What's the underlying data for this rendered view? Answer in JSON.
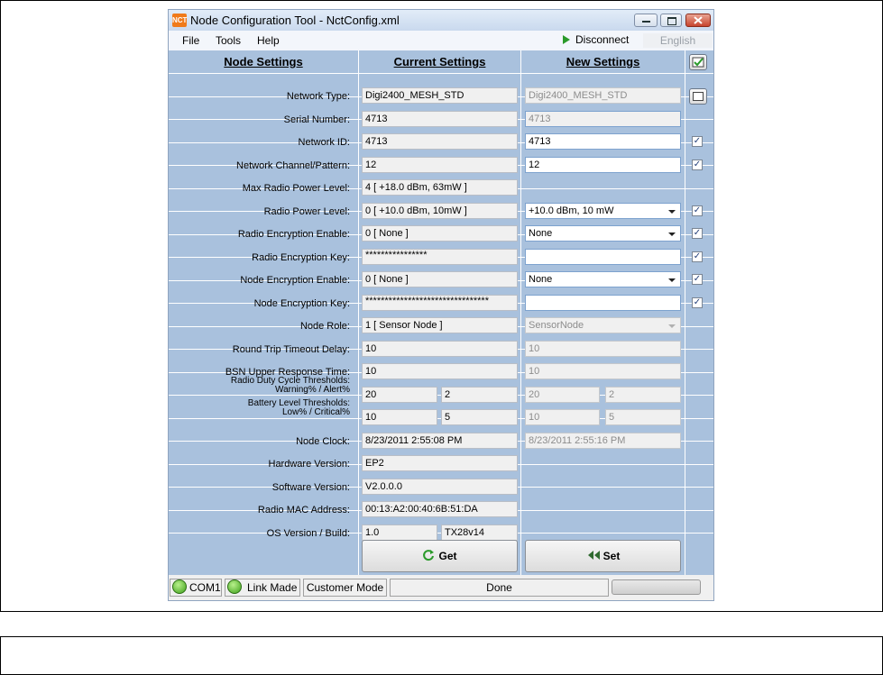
{
  "window": {
    "app_icon_text": "NCT",
    "title": "Node Configuration Tool - NctConfig.xml"
  },
  "menu": {
    "items": [
      "File",
      "Tools",
      "Help"
    ],
    "disconnect": "Disconnect",
    "language": "English"
  },
  "headers": {
    "node": "Node Settings",
    "current": "Current Settings",
    "new": "New Settings"
  },
  "rows": [
    {
      "label": "Network Type:",
      "current": "Digi2400_MESH_STD",
      "new": "Digi2400_MESH_STD"
    },
    {
      "label": "Serial Number:",
      "current": "4713",
      "new": "4713"
    },
    {
      "label": "Network ID:",
      "current": "4713",
      "new": "4713"
    },
    {
      "label": "Network Channel/Pattern:",
      "current": "12",
      "new": "12"
    },
    {
      "label": "Max Radio Power Level:",
      "current": "4  [ +18.0 dBm, 63mW ]"
    },
    {
      "label": "Radio Power Level:",
      "current": "0  [ +10.0 dBm, 10mW ]",
      "new": "+10.0 dBm, 10 mW"
    },
    {
      "label": "Radio Encryption Enable:",
      "current": "0  [ None ]",
      "new": "None"
    },
    {
      "label": "Radio Encryption Key:",
      "current": "****************",
      "new": ""
    },
    {
      "label": "Node Encryption Enable:",
      "current": "0  [ None ]",
      "new": "None"
    },
    {
      "label": "Node Encryption Key:",
      "current": "********************************",
      "new": ""
    },
    {
      "label": "Node Role:",
      "current": "1  [ Sensor Node ]",
      "new": "SensorNode"
    },
    {
      "label": "Round Trip Timeout Delay:",
      "current": "10",
      "new": "10"
    },
    {
      "label": "BSN Upper Response Time:",
      "current": "10",
      "new": "10"
    },
    {
      "label_line1": "Radio Duty Cycle Thresholds:",
      "label_line2": "Warning% / Alert%",
      "current_a": "20",
      "current_b": "2",
      "new_a": "20",
      "new_b": "2"
    },
    {
      "label_line1": "Battery Level Thresholds:",
      "label_line2": "Low% / Critical%",
      "current_a": "10",
      "current_b": "5",
      "new_a": "10",
      "new_b": "5"
    },
    {
      "label": "Node Clock:",
      "current": "8/23/2011 2:55:08 PM",
      "new": "8/23/2011 2:55:16 PM"
    },
    {
      "label": "Hardware Version:",
      "current": "EP2"
    },
    {
      "label": "Software Version:",
      "current": "V2.0.0.0"
    },
    {
      "label": "Radio MAC Address:",
      "current": "00:13:A2:00:40:6B:51:DA"
    },
    {
      "label": "OS Version / Build:",
      "current_a": "1.0",
      "current_b": "TX28v14"
    }
  ],
  "checks": {
    "check_all": true,
    "network_type": false,
    "network_id": true,
    "network_channel": true,
    "radio_power": true,
    "radio_enc_enable": true,
    "radio_enc_key": true,
    "node_enc_enable": true,
    "node_enc_key": true
  },
  "buttons": {
    "get": "Get",
    "set": "Set"
  },
  "status": {
    "port": "COM1",
    "link": "Link Made",
    "mode": "Customer Mode",
    "message": "Done"
  },
  "colors": {
    "grid": "#a9c1dd",
    "led": "#3ea11a"
  }
}
